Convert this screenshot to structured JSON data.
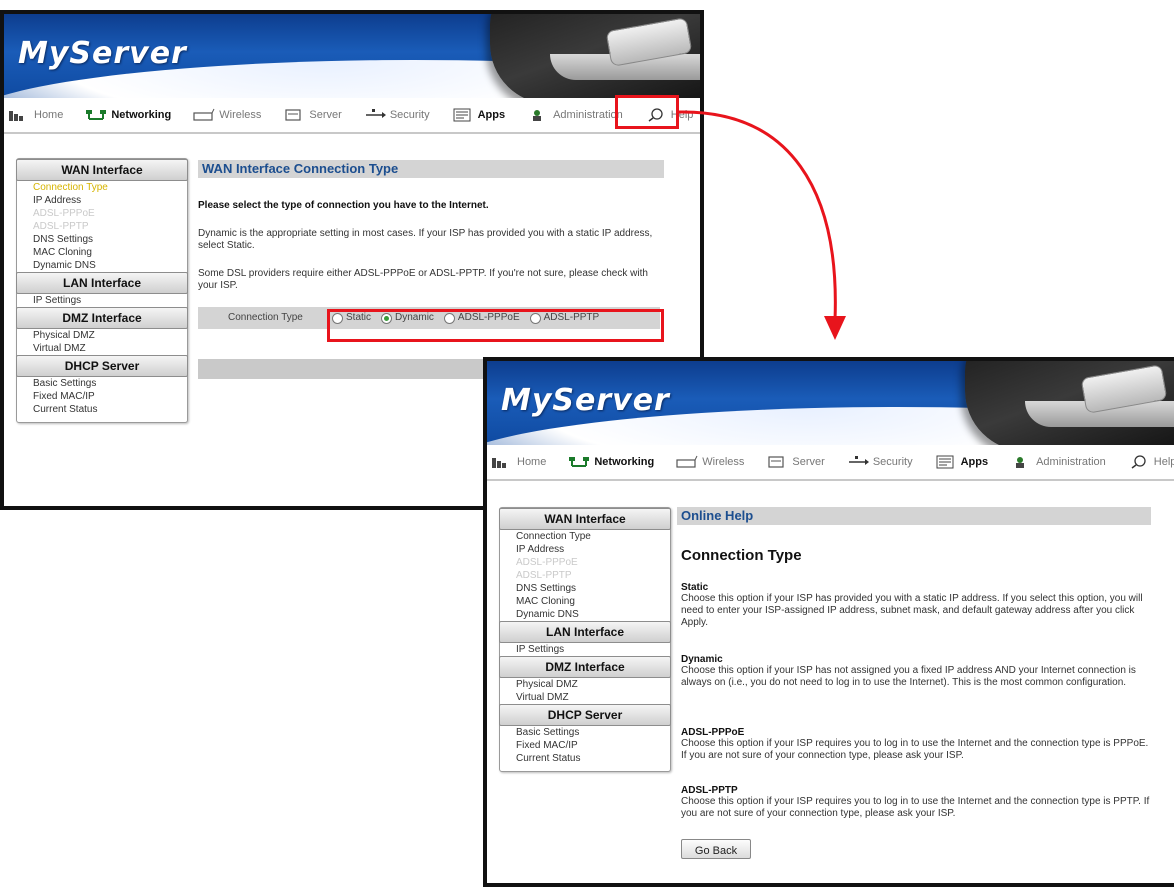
{
  "brand": "MyServer",
  "nav": {
    "home": "Home",
    "networking": "Networking",
    "wireless": "Wireless",
    "server": "Server",
    "security": "Security",
    "apps": "Apps",
    "administration": "Administration",
    "help": "Help"
  },
  "sidebar": {
    "wan_header": "WAN Interface",
    "wan_items": [
      "Connection Type",
      "IP Address",
      "ADSL-PPPoE",
      "ADSL-PPTP",
      "DNS Settings",
      "MAC Cloning",
      "Dynamic DNS"
    ],
    "lan_header": "LAN Interface",
    "lan_items": [
      "IP Settings"
    ],
    "dmz_header": "DMZ Interface",
    "dmz_items": [
      "Physical DMZ",
      "Virtual DMZ"
    ],
    "dhcp_header": "DHCP Server",
    "dhcp_items": [
      "Basic Settings",
      "Fixed MAC/IP",
      "Current Status"
    ]
  },
  "wan_page": {
    "title": "WAN Interface Connection Type",
    "prompt": "Please select the type of connection you have to the Internet.",
    "para1": "Dynamic is the appropriate setting in most cases. If your ISP has provided you with a static IP address, select Static.",
    "para2": "Some DSL providers require either ADSL-PPPoE or ADSL-PPTP. If you're not sure, please check with your ISP.",
    "conn_label": "Connection Type",
    "options": [
      "Static",
      "Dynamic",
      "ADSL-PPPoE",
      "ADSL-PPTP"
    ],
    "selected": "Dynamic",
    "question_mark": "?"
  },
  "help_page": {
    "section": "Online Help",
    "title": "Connection Type",
    "options": [
      {
        "name": "Static",
        "desc": "Choose this option if your ISP has provided you with a static IP address. If you select this option, you will need to enter your ISP-assigned IP address, subnet mask, and default gateway address after you click Apply."
      },
      {
        "name": "Dynamic",
        "desc": "Choose this option if your ISP has not assigned you a fixed IP address AND your Internet connection is always on (i.e., you do not need to log in to use the Internet). This is the most common configuration."
      },
      {
        "name": "ADSL-PPPoE",
        "desc": "Choose this option if your ISP requires you to log in to use the Internet and the connection type is PPPoE. If you are not sure of your connection type, please ask your ISP."
      },
      {
        "name": "ADSL-PPTP",
        "desc": "Choose this option if your ISP requires you to log in to use the Internet and the connection type is PPTP. If you are not sure of your connection type, please ask your ISP."
      }
    ],
    "go_back": "Go Back"
  },
  "colors": {
    "highlight": "#e8141c",
    "banner": "#1a5cb8",
    "section_title": "#1c4e8f",
    "active_link": "#d6b400"
  }
}
